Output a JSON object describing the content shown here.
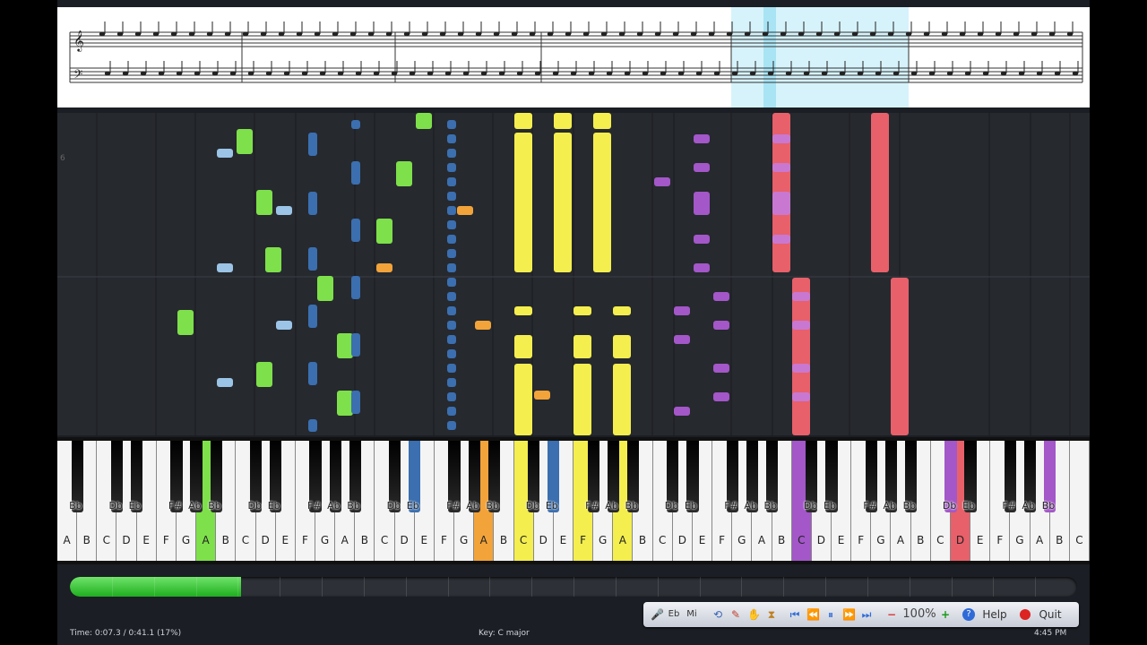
{
  "white_keys": [
    "A",
    "B",
    "C",
    "D",
    "E",
    "F",
    "G",
    "A",
    "B",
    "C",
    "D",
    "E",
    "F",
    "G",
    "A",
    "B",
    "C",
    "D",
    "E",
    "F",
    "G",
    "A",
    "B",
    "C",
    "D",
    "E",
    "F",
    "G",
    "A",
    "B",
    "C",
    "D",
    "E",
    "F",
    "G",
    "A",
    "B",
    "C",
    "D",
    "E",
    "F",
    "G",
    "A",
    "B",
    "C",
    "D",
    "E",
    "F",
    "G",
    "A",
    "B",
    "C"
  ],
  "black_key_labels": [
    "Bb",
    "Db",
    "Eb",
    "F#",
    "Ab",
    "Bb",
    "Db",
    "Eb",
    "F#",
    "Ab",
    "Bb",
    "Db",
    "Eb",
    "F#",
    "Ab",
    "Bb",
    "Db",
    "Eb",
    "F#",
    "Ab",
    "Bb",
    "Db",
    "Eb",
    "F#",
    "Ab",
    "Bb",
    "Db",
    "Eb",
    "F#",
    "Ab",
    "Bb",
    "Db",
    "Eb",
    "F#",
    "Ab",
    "Bb"
  ],
  "colors": {
    "green": "#7ee04a",
    "blue": "#3b6fb0",
    "orange": "#f2a33a",
    "yellow": "#f4ee4e",
    "purple": "#a357c8",
    "red": "#e8606a"
  },
  "progress": {
    "percent": 17
  },
  "toolbar": {
    "mic_label": "Mi",
    "eb_label": "Eb",
    "zoom": "100%",
    "help_label": "Help",
    "quit_label": "Quit"
  },
  "status": {
    "time": "Time:  0:07.3 / 0:41.1 (17%)",
    "key": "Key: C major",
    "clock": "4:45 PM"
  },
  "marker": "6"
}
